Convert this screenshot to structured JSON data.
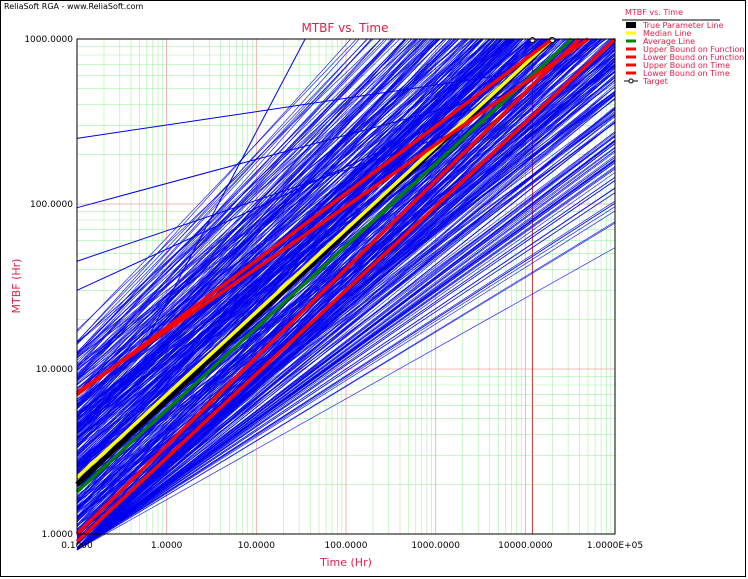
{
  "brand_text": "ReliaSoft RGA - www.ReliaSoft.com",
  "chart_data": {
    "type": "line",
    "title": "MTBF vs. Time",
    "xlabel": "Time (Hr)",
    "ylabel": "MTBF (Hr)",
    "x_scale": "log",
    "y_scale": "log",
    "xlim": [
      0.1,
      100000
    ],
    "ylim": [
      1,
      1000
    ],
    "x_tick_labels": [
      "0.1000",
      "1.0000",
      "10.0000",
      "100.0000",
      "1000.0000",
      "10000.0000",
      "1.0000E+05"
    ],
    "y_tick_labels": [
      "1.0000",
      "10.0000",
      "100.0000",
      "1000.0000"
    ],
    "grid": true,
    "legend_placement": "right",
    "legend_title": "MTBF vs. Time",
    "colors": {
      "simulation": "#0000ee",
      "true_parameter": "#000000",
      "median": "#ffff00",
      "average": "#008000",
      "bound": "#ff0000",
      "major_grid": "#f4a0a0",
      "minor_grid": "#a8f0a8",
      "text": "#e0204a"
    },
    "series": [
      {
        "name": "True Parameter Line",
        "x": [
          0.1,
          20000
        ],
        "y": [
          2.0,
          1000
        ],
        "color": "#000000"
      },
      {
        "name": "Median Line",
        "x": [
          0.1,
          20000
        ],
        "y": [
          2.2,
          1000
        ],
        "color": "#ffff00"
      },
      {
        "name": "Average Line",
        "x": [
          0.1,
          33000
        ],
        "y": [
          1.8,
          1000
        ],
        "color": "#008000"
      },
      {
        "name": "Upper Bound on Function",
        "x": [
          0.1,
          50000
        ],
        "y": [
          7.2,
          1000
        ],
        "color": "#ff0000"
      },
      {
        "name": "Lower Bound on Function",
        "x": [
          0.1,
          100000
        ],
        "y": [
          0.9,
          1000
        ],
        "color": "#ff0000"
      },
      {
        "name": "Upper Bound on Time",
        "x": [
          0.1,
          20000
        ],
        "y": [
          7.0,
          1000
        ],
        "color": "#ff0000"
      },
      {
        "name": "Lower Bound on Time",
        "x": [
          0.1,
          40000
        ],
        "y": [
          1.0,
          1000
        ],
        "color": "#ff0000"
      },
      {
        "name": "Target",
        "x": [
          12000,
          20000
        ],
        "y": [
          1000,
          1000
        ],
        "color": "#000000"
      }
    ],
    "target_line": {
      "x": 12000,
      "y": 1000
    }
  }
}
